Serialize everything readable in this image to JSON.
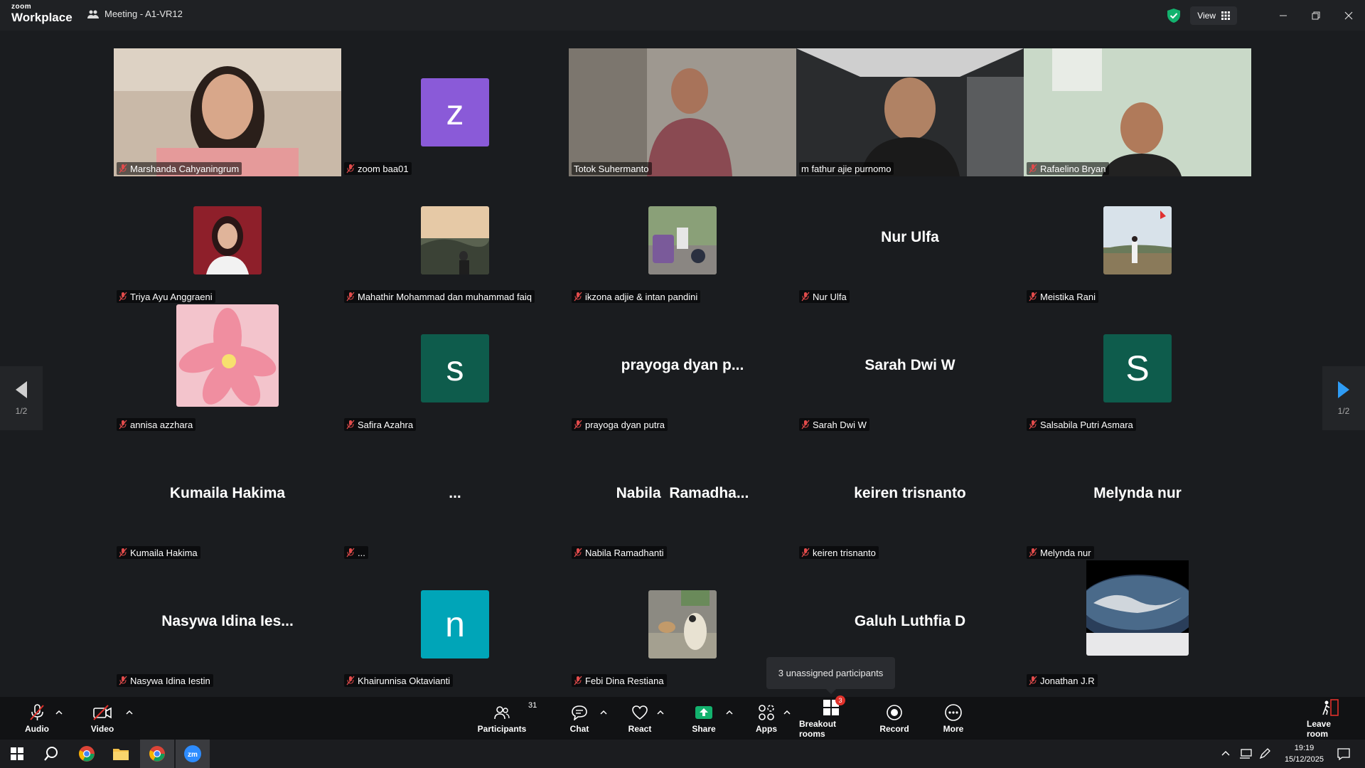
{
  "app": {
    "brand_top": "zoom",
    "brand_bottom": "Workplace",
    "meeting_title": "Meeting - A1-VR12",
    "view_label": "View"
  },
  "colors": {
    "active_speaker": "#23d18b",
    "avatar_z": "#8a5ad8",
    "avatar_s": "#0e5c4c",
    "avatar_n": "#00a5b8",
    "share_green": "#13b26e",
    "badge_red": "#e0312b"
  },
  "tiles": [
    {
      "id": "t1",
      "name": "Marshanda Cahyaningrum",
      "type": "video",
      "icon": "photo-woman"
    },
    {
      "id": "t2",
      "name": "zoom baa01",
      "type": "avatar-letter",
      "letter": "z"
    },
    {
      "id": "t3",
      "name": "Totok Suhermanto",
      "type": "video",
      "icon": "photo-older-man"
    },
    {
      "id": "t4",
      "name": "m fathur ajie purnomo",
      "type": "video",
      "active": true,
      "icon": "photo-young-man"
    },
    {
      "id": "t5",
      "name": "Rafaelino Bryan",
      "type": "video",
      "icon": "photo-man-room"
    },
    {
      "id": "t6",
      "name": "Triya Ayu Anggraeni",
      "type": "avatar-photo",
      "icon": "photo-portrait"
    },
    {
      "id": "t7",
      "name": "Mahathir Mohammad dan muhammad faiq",
      "type": "avatar-photo",
      "icon": "photo-landscape"
    },
    {
      "id": "t8",
      "name": "ikzona adjie & intan pandini",
      "type": "avatar-photo",
      "icon": "photo-street"
    },
    {
      "id": "t9",
      "name": "Nur Ulfa",
      "type": "name",
      "display": "Nur Ulfa"
    },
    {
      "id": "t10",
      "name": "Meistika Rani",
      "type": "avatar-photo",
      "icon": "photo-mountain"
    },
    {
      "id": "t11",
      "name": "annisa azzhara",
      "type": "avatar-photo-large",
      "icon": "photo-flower"
    },
    {
      "id": "t12",
      "name": "Safira Azahra",
      "type": "avatar-letter",
      "letter": "s"
    },
    {
      "id": "t13",
      "name": "prayoga dyan putra",
      "type": "name",
      "display": "prayoga dyan p..."
    },
    {
      "id": "t14",
      "name": "Sarah Dwi W",
      "type": "name",
      "display": "Sarah Dwi W"
    },
    {
      "id": "t15",
      "name": "Salsabila Putri Asmara",
      "type": "avatar-letter",
      "letter": "S"
    },
    {
      "id": "t16",
      "name": "Kumaila Hakima",
      "type": "name",
      "display": "Kumaila Hakima"
    },
    {
      "id": "t17",
      "name": "...",
      "type": "name",
      "display": "..."
    },
    {
      "id": "t18",
      "name": "Nabila Ramadhanti",
      "type": "name",
      "display": "Nabila  Ramadha..."
    },
    {
      "id": "t19",
      "name": "keiren trisnanto",
      "type": "name",
      "display": "keiren trisnanto"
    },
    {
      "id": "t20",
      "name": "Melynda nur",
      "type": "name",
      "display": "Melynda nur"
    },
    {
      "id": "t21",
      "name": "Nasywa Idina Iestin",
      "type": "name",
      "display": "Nasywa Idina Ies..."
    },
    {
      "id": "t22",
      "name": "Khairunnisa Oktavianti",
      "type": "avatar-letter",
      "letter": "n"
    },
    {
      "id": "t23",
      "name": "Febi Dina Restiana",
      "type": "avatar-photo",
      "icon": "photo-animal"
    },
    {
      "id": "t24",
      "name": "",
      "type": "name",
      "display": "Galuh Luthfia D",
      "hide_namebar": true
    },
    {
      "id": "t25",
      "name": "Jonathan J.R",
      "type": "avatar-photo-large",
      "icon": "photo-earth"
    }
  ],
  "paging": {
    "left": "1/2",
    "right": "1/2"
  },
  "tooltip": "3 unassigned participants",
  "toolbar": {
    "audio": "Audio",
    "video": "Video",
    "participants": "Participants",
    "participants_count": "31",
    "chat": "Chat",
    "react": "React",
    "share": "Share",
    "apps": "Apps",
    "breakout": "Breakout rooms",
    "breakout_badge": "3",
    "record": "Record",
    "more": "More",
    "leave": "Leave room"
  },
  "taskbar": {
    "time": "19:19",
    "date": "15/12/2025"
  }
}
